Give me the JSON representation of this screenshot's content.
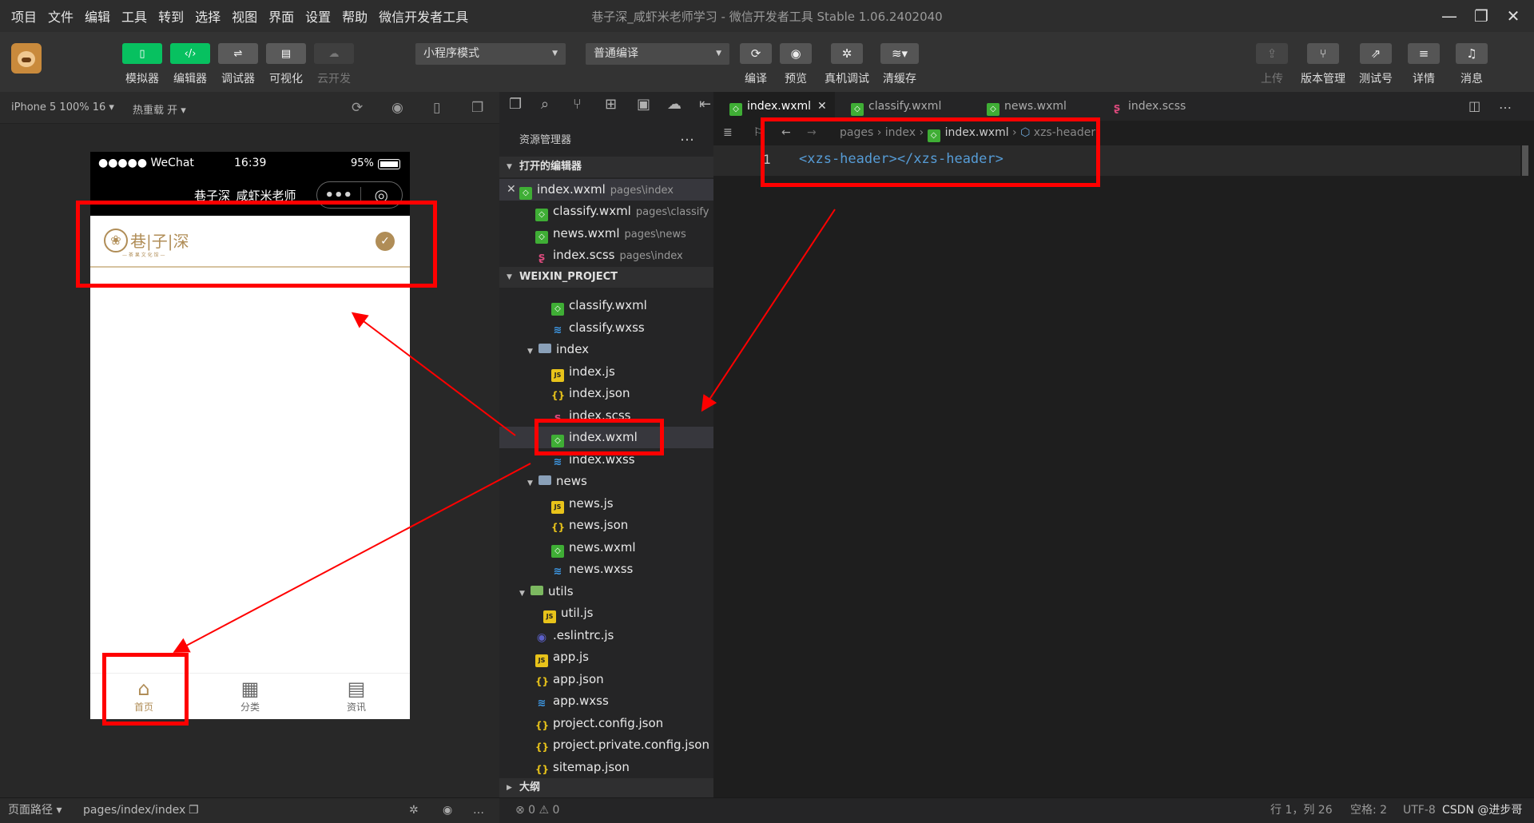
{
  "app": {
    "window_title": "巷子深_咸虾米老师学习 - 微信开发者工具 Stable 1.06.2402040"
  },
  "menu": [
    "项目",
    "文件",
    "编辑",
    "工具",
    "转到",
    "选择",
    "视图",
    "界面",
    "设置",
    "帮助",
    "微信开发者工具"
  ],
  "toolbar": {
    "simulator": "模拟器",
    "editor": "编辑器",
    "debugger": "调试器",
    "visual": "可视化",
    "cloud": "云开发",
    "mode_select": "小程序模式",
    "compile_select": "普通编译",
    "compile": "编译",
    "preview": "预览",
    "real_debug": "真机调试",
    "clear_cache": "清缓存",
    "upload": "上传",
    "version": "版本管理",
    "test_account": "测试号",
    "details": "详情",
    "messages": "消息"
  },
  "simbar": {
    "device": "iPhone 5 100% 16",
    "hot_reload": "热重载 开"
  },
  "phone": {
    "carrier": "●●●●● WeChat",
    "time": "16:39",
    "battery": "95%",
    "nav_title": "巷子深_咸虾米老师",
    "brand_text": "巷|子|深",
    "brand_sub": "— 茶 果 文 化 馆 —",
    "tabs": [
      {
        "label": "首页",
        "icon": "home-icon"
      },
      {
        "label": "分类",
        "icon": "grid-icon"
      },
      {
        "label": "资讯",
        "icon": "news-icon"
      }
    ]
  },
  "explorer": {
    "title": "资源管理器",
    "open_editors_label": "打开的编辑器",
    "open_editors": [
      {
        "name": "index.wxml",
        "path": "pages\\index",
        "type": "wxml"
      },
      {
        "name": "classify.wxml",
        "path": "pages\\classify",
        "type": "wxml"
      },
      {
        "name": "news.wxml",
        "path": "pages\\news",
        "type": "wxml"
      },
      {
        "name": "index.scss",
        "path": "pages\\index",
        "type": "scss"
      }
    ],
    "project_label": "WEIXIN_PROJECT",
    "tree": [
      {
        "name": "classify.wxml",
        "type": "wxml"
      },
      {
        "name": "classify.wxss",
        "type": "wxss"
      },
      {
        "name": "index",
        "type": "folder"
      },
      {
        "name": "index.js",
        "type": "js"
      },
      {
        "name": "index.json",
        "type": "json"
      },
      {
        "name": "index.scss",
        "type": "scss"
      },
      {
        "name": "index.wxml",
        "type": "wxml"
      },
      {
        "name": "index.wxss",
        "type": "wxss"
      },
      {
        "name": "news",
        "type": "folder"
      },
      {
        "name": "news.js",
        "type": "js"
      },
      {
        "name": "news.json",
        "type": "json"
      },
      {
        "name": "news.wxml",
        "type": "wxml"
      },
      {
        "name": "news.wxss",
        "type": "wxss"
      },
      {
        "name": "utils",
        "type": "folder"
      },
      {
        "name": "util.js",
        "type": "js"
      },
      {
        "name": ".eslintrc.js",
        "type": "eslint"
      },
      {
        "name": "app.js",
        "type": "js"
      },
      {
        "name": "app.json",
        "type": "json"
      },
      {
        "name": "app.wxss",
        "type": "wxss"
      },
      {
        "name": "project.config.json",
        "type": "json"
      },
      {
        "name": "project.private.config.json",
        "type": "json"
      },
      {
        "name": "sitemap.json",
        "type": "json"
      }
    ],
    "outline_label": "大纲"
  },
  "editor": {
    "tabs": [
      "index.wxml",
      "classify.wxml",
      "news.wxml",
      "index.scss"
    ],
    "breadcrumb": [
      "pages",
      "index",
      "index.wxml",
      "xzs-header"
    ],
    "line_number": "1",
    "code": "<xzs-header></xzs-header>"
  },
  "statusbar": {
    "page_path_label": "页面路径",
    "page_path": "pages/index/index",
    "problems": "⊗ 0 ⚠ 0",
    "cursor": "行 1，列 26",
    "spaces": "空格: 2",
    "encoding": "UTF-8",
    "watermark": "CSDN @进步哥"
  },
  "colors": {
    "accent_green": "#07c160",
    "annotation_red": "#ff0000",
    "brand_gold": "#b08d57"
  }
}
